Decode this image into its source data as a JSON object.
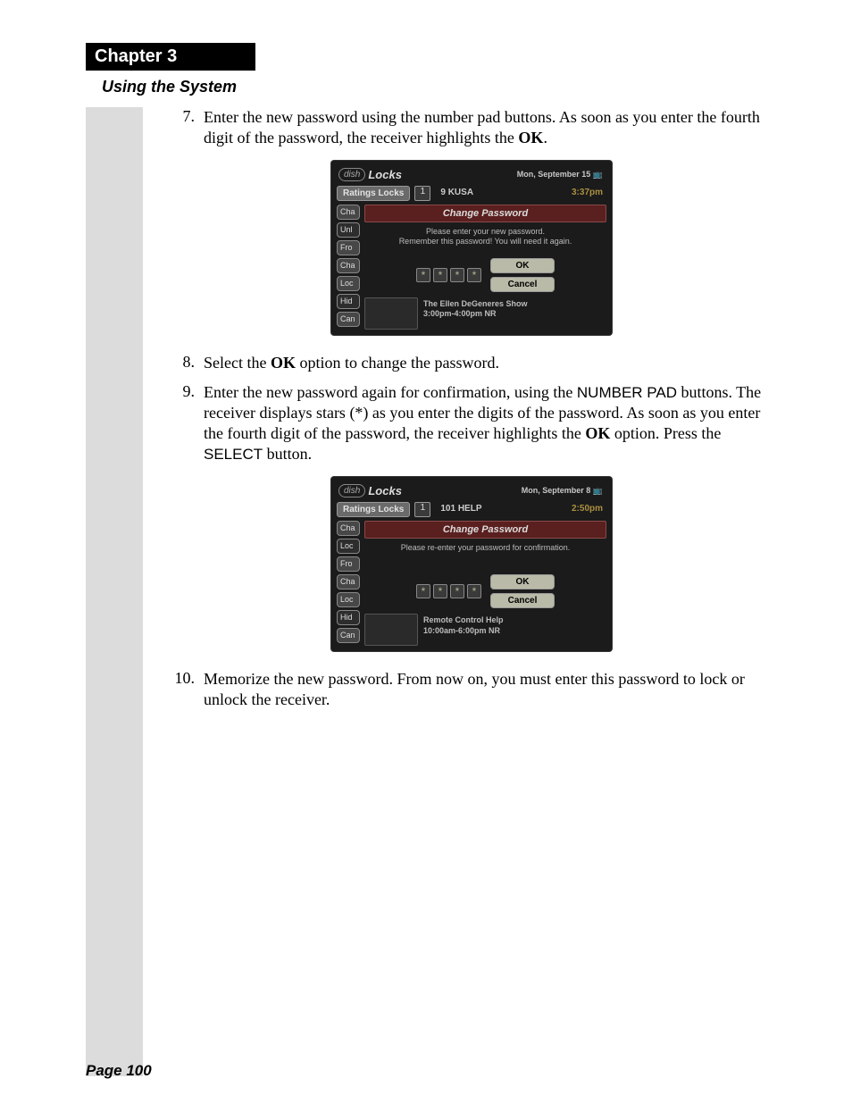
{
  "chapter": "Chapter 3",
  "section": "Using the System",
  "steps": [
    {
      "num": "7.",
      "pre": "Enter the new password using the number pad buttons. As soon as you enter the fourth digit of the password, the receiver highlights the ",
      "bold": "OK",
      "post": "."
    },
    {
      "num": "8.",
      "pre": "Select the ",
      "bold": "OK",
      "post": " option to change the password."
    },
    {
      "num": "9.",
      "t1": "Enter the new password again for confirmation, using the ",
      "sans1": "NUMBER PAD",
      "t2": " buttons. The receiver displays stars (*) as you enter the digits of the password. As soon as you enter the fourth digit of the password, the receiver highlights the ",
      "bold": "OK",
      "t3": " option. Press the ",
      "sans2": "SELECT",
      "t4": " button."
    },
    {
      "num": "10.",
      "text": "Memorize the new password. From now on, you must enter this password to lock or unlock the receiver."
    }
  ],
  "shot1": {
    "logo": "dish",
    "title": "Locks",
    "date": "Mon, September 15",
    "tab": "Ratings Locks",
    "chnum": "1",
    "channel": "9 KUSA",
    "time": "3:37pm",
    "pills": [
      "Cha",
      "Unl",
      "Fro",
      "Cha",
      "Loc",
      "Hid",
      "Can"
    ],
    "banner": "Change Password",
    "msg1": "Please enter your new password.",
    "msg2": "Remember this password! You will need it again.",
    "ok": "OK",
    "cancel": "Cancel",
    "prog1": "The Ellen DeGeneres Show",
    "prog2": "3:00pm-4:00pm NR"
  },
  "shot2": {
    "logo": "dish",
    "title": "Locks",
    "date": "Mon, September 8",
    "tab": "Ratings Locks",
    "chnum": "1",
    "channel": "101 HELP",
    "time": "2:50pm",
    "pills": [
      "Cha",
      "Loc",
      "Fro",
      "Cha",
      "Loc",
      "Hid",
      "Can"
    ],
    "banner": "Change Password",
    "msg1": "Please re-enter your password for confirmation.",
    "ok": "OK",
    "cancel": "Cancel",
    "prog1": "Remote Control Help",
    "prog2": "10:00am-6:00pm NR"
  },
  "footer": "Page 100"
}
